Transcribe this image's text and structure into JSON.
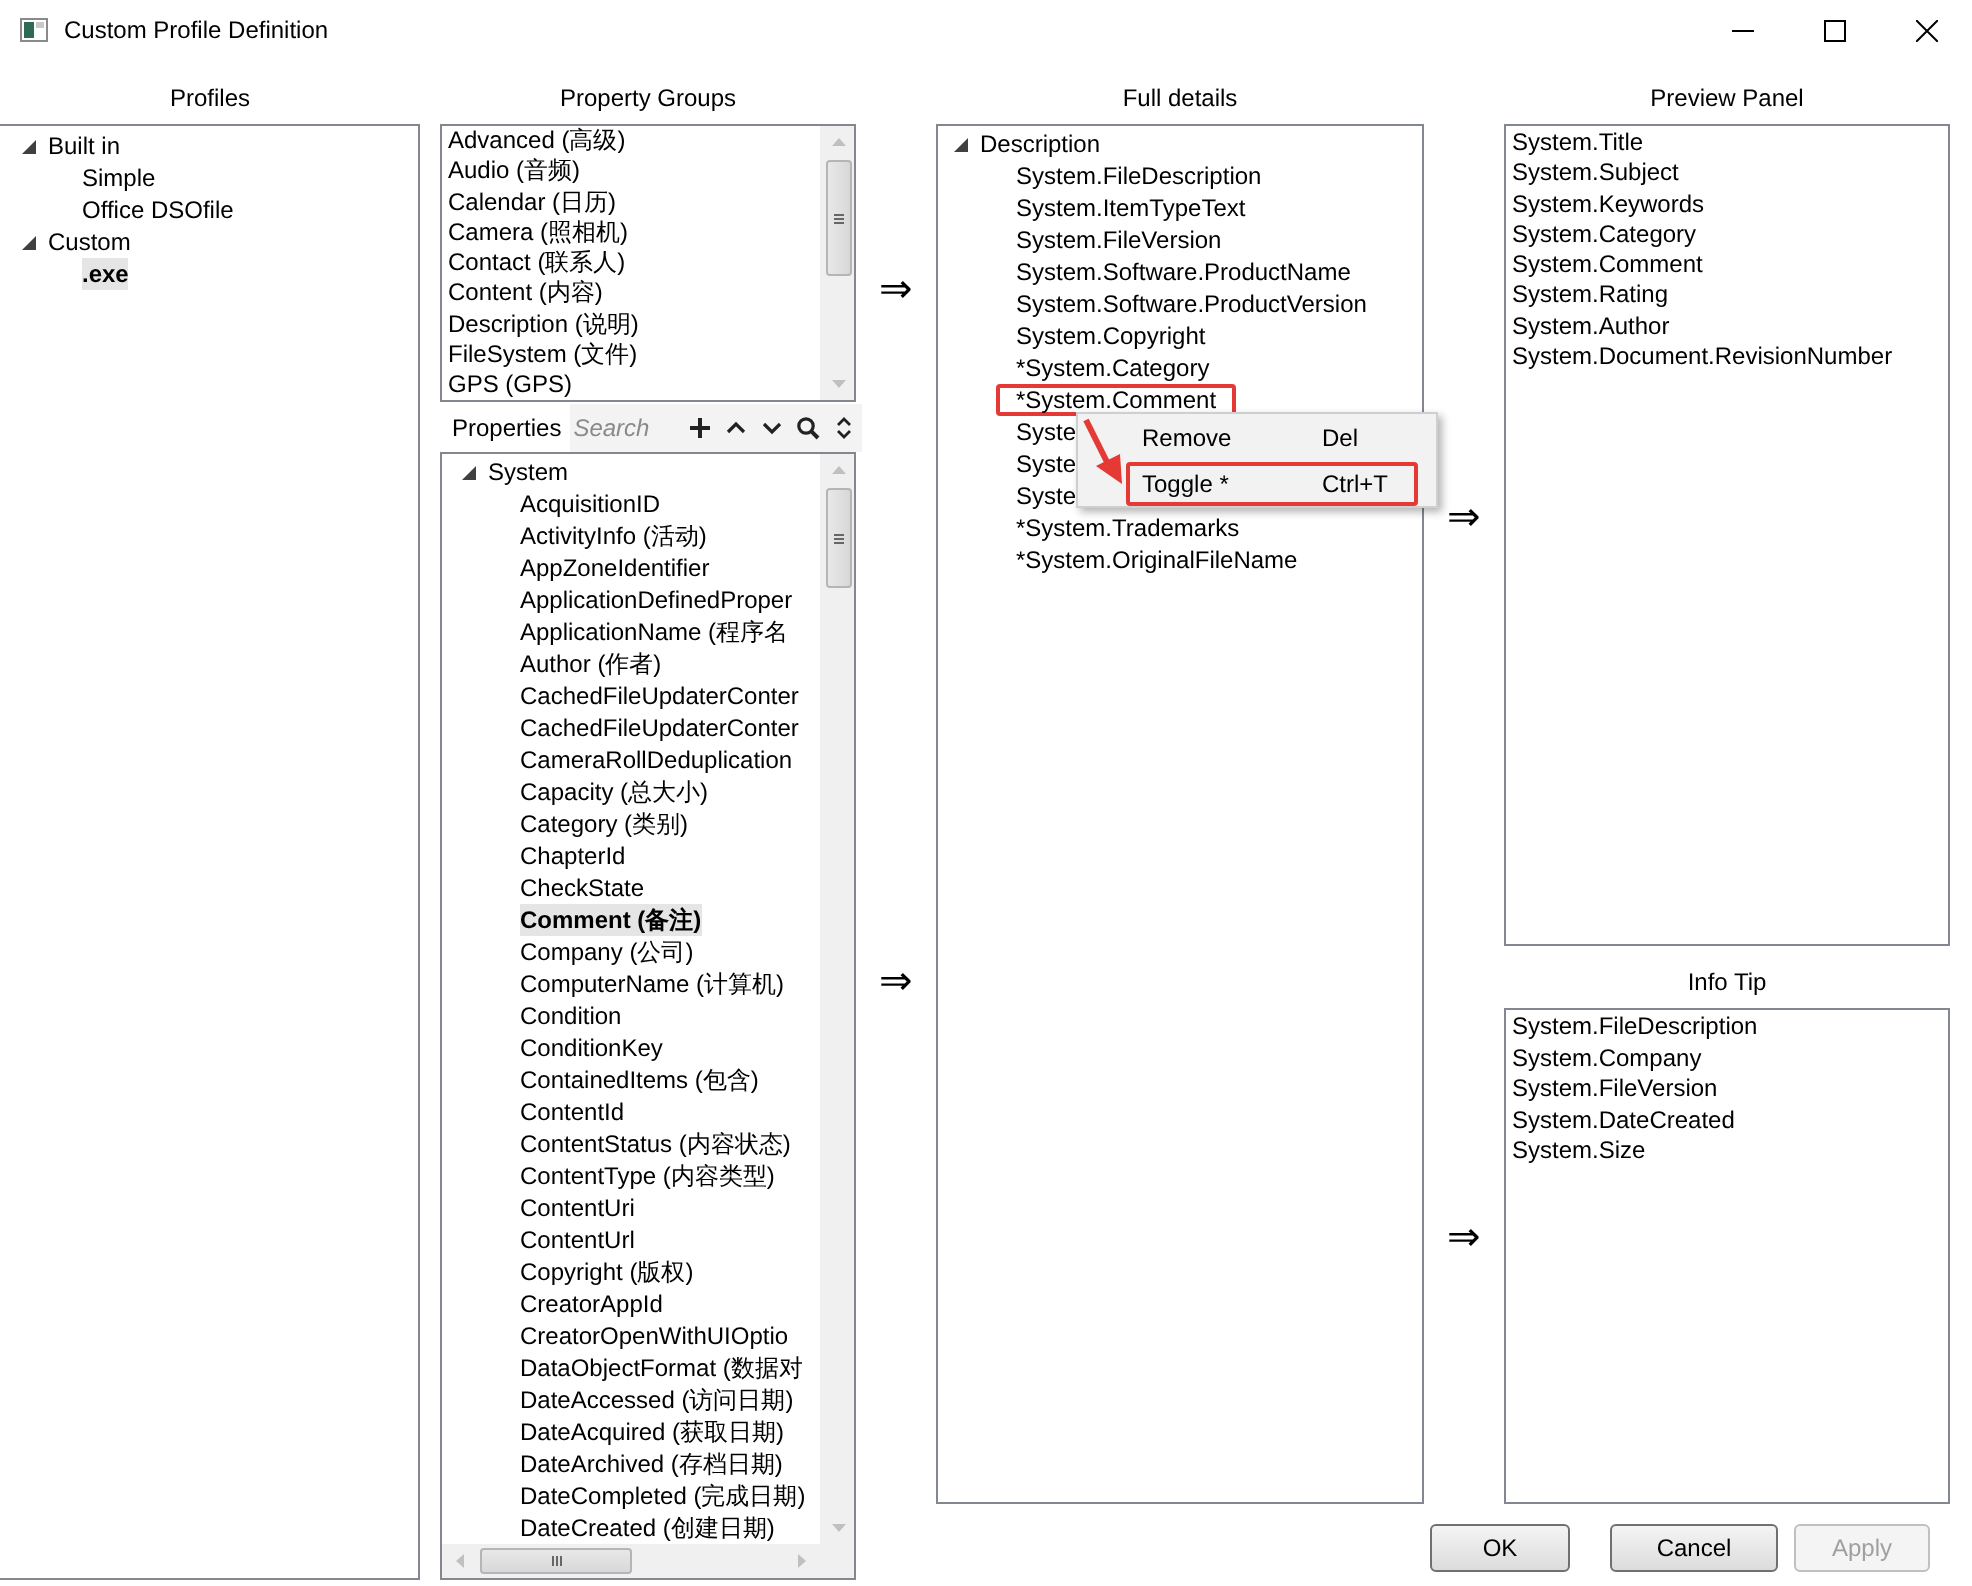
{
  "window": {
    "title": "Custom Profile Definition"
  },
  "profiles": {
    "header": "Profiles",
    "tree": [
      {
        "label": "Built in",
        "expanded": true,
        "children": [
          {
            "label": "Simple",
            "selected": false
          },
          {
            "label": "Office DSOfile",
            "selected": false
          }
        ]
      },
      {
        "label": "Custom",
        "expanded": true,
        "children": [
          {
            "label": ".exe",
            "selected": true
          }
        ]
      }
    ]
  },
  "property_groups": {
    "header": "Property Groups",
    "arrow": "⇒",
    "items": [
      "Advanced (高级)",
      "Audio (音频)",
      "Calendar (日历)",
      "Camera (照相机)",
      "Contact (联系人)",
      "Content (内容)",
      "Description (说明)",
      "FileSystem (文件)",
      "GPS (GPS)"
    ]
  },
  "properties": {
    "label": "Properties",
    "search": {
      "placeholder": "Search"
    },
    "arrow": "⇒",
    "tree": {
      "label": "System",
      "expanded": true,
      "children": [
        {
          "label": "AcquisitionID",
          "selected": false
        },
        {
          "label": "ActivityInfo (活动)",
          "selected": false
        },
        {
          "label": "AppZoneIdentifier",
          "selected": false
        },
        {
          "label": "ApplicationDefinedProper",
          "selected": false
        },
        {
          "label": "ApplicationName (程序名",
          "selected": false
        },
        {
          "label": "Author (作者)",
          "selected": false
        },
        {
          "label": "CachedFileUpdaterConter",
          "selected": false
        },
        {
          "label": "CachedFileUpdaterConter",
          "selected": false
        },
        {
          "label": "CameraRollDeduplication",
          "selected": false
        },
        {
          "label": "Capacity (总大小)",
          "selected": false
        },
        {
          "label": "Category (类别)",
          "selected": false
        },
        {
          "label": "ChapterId",
          "selected": false
        },
        {
          "label": "CheckState",
          "selected": false
        },
        {
          "label": "Comment (备注)",
          "selected": true
        },
        {
          "label": "Company (公司)",
          "selected": false
        },
        {
          "label": "ComputerName (计算机)",
          "selected": false
        },
        {
          "label": "Condition",
          "selected": false
        },
        {
          "label": "ConditionKey",
          "selected": false
        },
        {
          "label": "ContainedItems (包含)",
          "selected": false
        },
        {
          "label": "ContentId",
          "selected": false
        },
        {
          "label": "ContentStatus (内容状态)",
          "selected": false
        },
        {
          "label": "ContentType (内容类型)",
          "selected": false
        },
        {
          "label": "ContentUri",
          "selected": false
        },
        {
          "label": "ContentUrl",
          "selected": false
        },
        {
          "label": "Copyright (版权)",
          "selected": false
        },
        {
          "label": "CreatorAppId",
          "selected": false
        },
        {
          "label": "CreatorOpenWithUIOptio",
          "selected": false
        },
        {
          "label": "DataObjectFormat (数据对",
          "selected": false
        },
        {
          "label": "DateAccessed (访问日期)",
          "selected": false
        },
        {
          "label": "DateAcquired (获取日期)",
          "selected": false
        },
        {
          "label": "DateArchived (存档日期)",
          "selected": false
        },
        {
          "label": "DateCompleted (完成日期)",
          "selected": false
        },
        {
          "label": "DateCreated (创建日期)",
          "selected": false
        }
      ]
    }
  },
  "full_details": {
    "header": "Full details",
    "arrows": [
      "⇒",
      "⇒"
    ],
    "tree": {
      "label": "Description",
      "expanded": true,
      "children": [
        {
          "label": "System.FileDescription",
          "annotated": false
        },
        {
          "label": "System.ItemTypeText",
          "annotated": false
        },
        {
          "label": "System.FileVersion",
          "annotated": false
        },
        {
          "label": "System.Software.ProductName",
          "annotated": false
        },
        {
          "label": "System.Software.ProductVersion",
          "annotated": false
        },
        {
          "label": "System.Copyright",
          "annotated": false
        },
        {
          "label": "*System.Category",
          "annotated": false
        },
        {
          "label": "*System.Comment",
          "annotated": true
        },
        {
          "label": "Syste",
          "annotated": false
        },
        {
          "label": "Syste",
          "annotated": false
        },
        {
          "label": "Syste",
          "annotated": false
        },
        {
          "label": "*System.Trademarks",
          "annotated": false
        },
        {
          "label": "*System.OriginalFileName",
          "annotated": false
        }
      ]
    },
    "context_menu": {
      "items": [
        {
          "label": "Remove",
          "shortcut": "Del",
          "annotated": false
        },
        {
          "label": "Toggle *",
          "shortcut": "Ctrl+T",
          "annotated": true
        }
      ]
    }
  },
  "preview_panel": {
    "header": "Preview Panel",
    "items": [
      "System.Title",
      "System.Subject",
      "System.Keywords",
      "System.Category",
      "System.Comment",
      "System.Rating",
      "System.Author",
      "System.Document.RevisionNumber"
    ]
  },
  "info_tip": {
    "header": "Info Tip",
    "items": [
      "System.FileDescription",
      "System.Company",
      "System.FileVersion",
      "System.DateCreated",
      "System.Size"
    ]
  },
  "buttons": [
    {
      "label": "OK",
      "disabled": false
    },
    {
      "label": "Cancel",
      "disabled": false
    },
    {
      "label": "Apply",
      "disabled": true
    }
  ]
}
